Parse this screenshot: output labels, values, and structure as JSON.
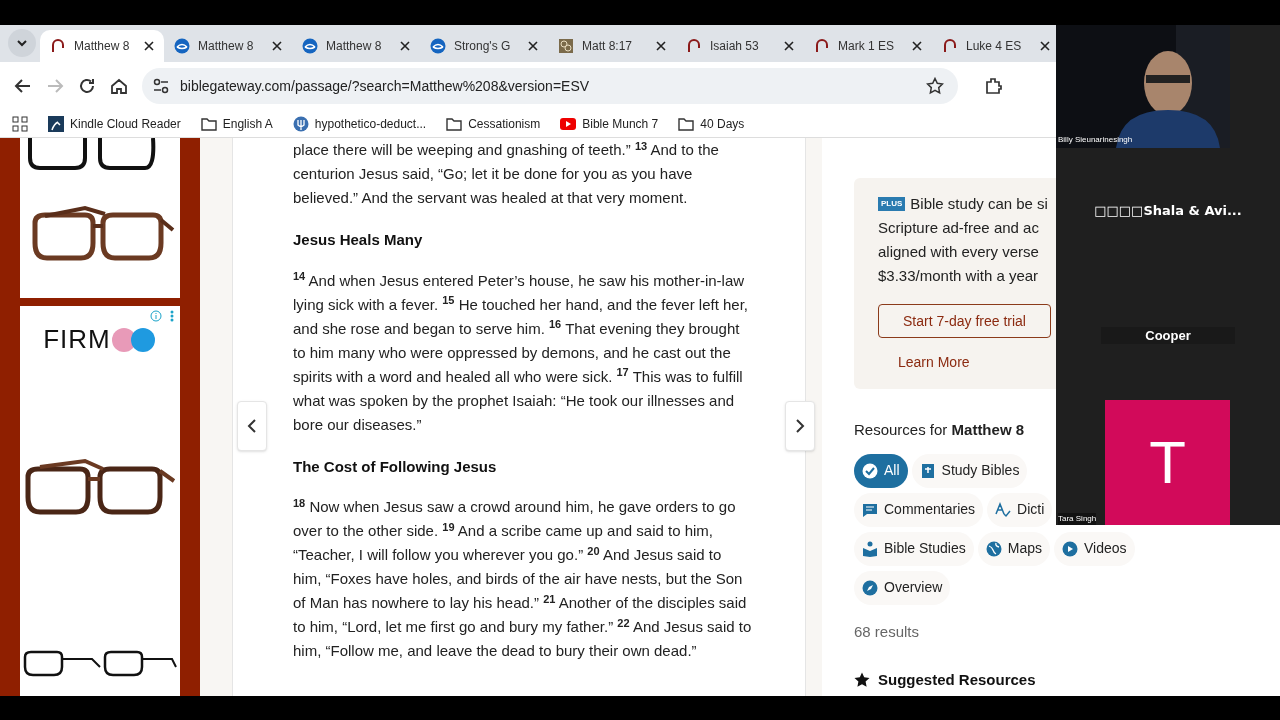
{
  "tabs": [
    {
      "title": "Matthew 8",
      "kind": "gateway",
      "selected": true
    },
    {
      "title": "Matthew 8",
      "kind": "blue",
      "selected": false
    },
    {
      "title": "Matthew 8",
      "kind": "blue",
      "selected": false
    },
    {
      "title": "Strong's G",
      "kind": "blue",
      "selected": false
    },
    {
      "title": "Matt 8:17",
      "kind": "brown",
      "selected": false
    },
    {
      "title": "Isaiah 53",
      "kind": "gateway",
      "selected": false
    },
    {
      "title": "Mark 1 ES",
      "kind": "gateway",
      "selected": false
    },
    {
      "title": "Luke 4 ES",
      "kind": "gateway",
      "selected": false
    }
  ],
  "address_bar": {
    "url": "biblegateway.com/passage/?search=Matthew%208&version=ESV"
  },
  "bookmarks": [
    {
      "label": "Kindle Cloud Reader",
      "kind": "kindle"
    },
    {
      "label": "English A",
      "kind": "folder"
    },
    {
      "label": "hypothetico-deduct...",
      "kind": "site"
    },
    {
      "label": "Cessationism",
      "kind": "folder"
    },
    {
      "label": "Bible Munch 7",
      "kind": "video"
    },
    {
      "label": "40 Days",
      "kind": "folder"
    }
  ],
  "ads": {
    "logo": "FIRM"
  },
  "passage": [
    {
      "kind": "paragraph",
      "text": "place there will be weeping and gnashing of teeth.” $^{13}$ And to the centurion Jesus said, “Go; let it be done for you as you have believed.” And the servant was healed at that very moment."
    },
    {
      "kind": "heading",
      "text": "Jesus Heals Many"
    },
    {
      "kind": "paragraph",
      "text": "$^{14}$ And when Jesus entered Peter’s house, he saw his mother-in-law lying sick with a fever. $^{15}$ He touched her hand, and the fever left her, and she rose and began to serve him. $^{16}$ That evening they brought to him many who were oppressed by demons, and he cast out the spirits with a word and healed all who were sick. $^{17}$ This was to fulfill what was spoken by the prophet Isaiah: “He took our illnesses and bore our diseases.”"
    },
    {
      "kind": "heading",
      "text": "The Cost of Following Jesus"
    },
    {
      "kind": "paragraph",
      "text": "$^{18}$ Now when Jesus saw a crowd around him, he gave orders to go over to the other side. $^{19}$ And a scribe came up and said to him, “Teacher, I will follow you wherever you go.” $^{20}$ And Jesus said to him, “Foxes have holes, and birds of the air have nests, but the Son of Man has nowhere to lay his head.” $^{21}$ Another of the disciples said to him, “Lord, let me first go and bury my father.” $^{22}$ And Jesus said to him, “Follow me, and leave the dead to bury their own dead.”"
    }
  ],
  "promo": {
    "badge": "PLUS",
    "lines": [
      "Bible study can be si",
      "Scripture ad-free and ac",
      "aligned with every verse",
      "$3.33/month with a year"
    ],
    "button": "Start 7-day free trial",
    "link": "Learn More"
  },
  "resources": {
    "title": "Resources for **Matthew 8**",
    "chip_rows": [
      [
        {
          "label": "All",
          "kind": "check",
          "selected": true
        },
        {
          "label": "Study Bibles",
          "kind": "book",
          "selected": false
        }
      ],
      [
        {
          "label": "Commentaries",
          "kind": "comment",
          "selected": false
        },
        {
          "label": "Dicti",
          "kind": "dictionary",
          "selected": false
        }
      ],
      [
        {
          "label": "Bible Studies",
          "kind": "reader",
          "selected": false
        },
        {
          "label": "Maps",
          "kind": "globe",
          "selected": false
        },
        {
          "label": "Videos",
          "kind": "play",
          "selected": false
        }
      ],
      [
        {
          "label": "Overview",
          "kind": "compass",
          "selected": false
        }
      ]
    ],
    "count": "68 results",
    "suggested": "Suggested Resources"
  },
  "video_call": {
    "participants": [
      {
        "name": "Billy Sieunarinesingh",
        "kind": "camera"
      },
      {
        "name": "□□□□Shala & Avi...",
        "kind": "name"
      },
      {
        "name": "Cooper",
        "kind": "label"
      },
      {
        "name": "Tara Singh",
        "kind": "avatar",
        "initial": "T",
        "color": "#d20a5a"
      }
    ]
  }
}
